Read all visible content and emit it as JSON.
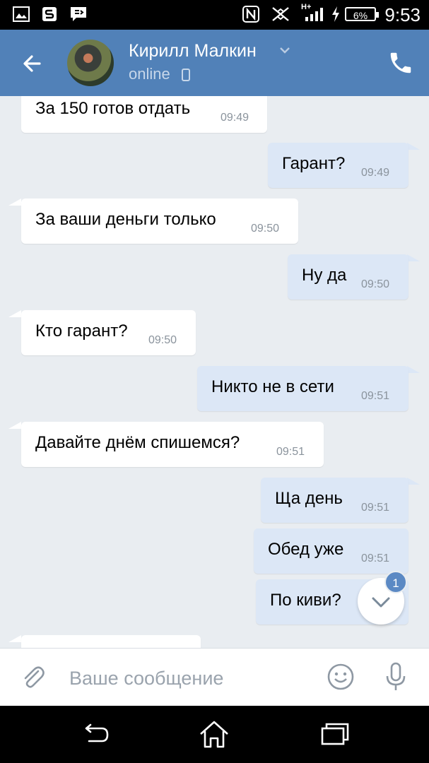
{
  "status_bar": {
    "time": "9:53",
    "battery": "6%",
    "network": "H+"
  },
  "header": {
    "contact_name": "Кирилл Малкин",
    "status": "online"
  },
  "messages": [
    {
      "dir": "in",
      "text": "За 150 готов отдать",
      "time": "09:49"
    },
    {
      "dir": "out",
      "text": "Гарант?",
      "time": "09:49"
    },
    {
      "dir": "in",
      "text": "За ваши деньги только",
      "time": "09:50"
    },
    {
      "dir": "out",
      "text": "Ну да",
      "time": "09:50"
    },
    {
      "dir": "in",
      "text": "Кто гарант?",
      "time": "09:50"
    },
    {
      "dir": "out",
      "text": "Никто не в сети",
      "time": "09:51"
    },
    {
      "dir": "in",
      "text": "Давайте днём спишемся?",
      "time": "09:51"
    },
    {
      "dir": "out",
      "text": "Ща день",
      "time": "09:51"
    },
    {
      "dir": "out",
      "text": "Обед уже",
      "time": "09:51"
    },
    {
      "dir": "out",
      "text": "По киви?",
      "time": ""
    }
  ],
  "scroll_down": {
    "badge_count": "1"
  },
  "composer": {
    "placeholder": "Ваше сообщение"
  },
  "icons": {
    "attach": "paperclip-icon",
    "emoji": "smile-icon",
    "mic": "microphone-icon",
    "call": "phone-icon",
    "back": "arrow-left-icon"
  },
  "colors": {
    "header": "#5181b8",
    "outgoing_bubble": "#dce7f6",
    "incoming_bubble": "#ffffff",
    "chat_background": "#e9edf1",
    "badge": "#5b89c4"
  }
}
